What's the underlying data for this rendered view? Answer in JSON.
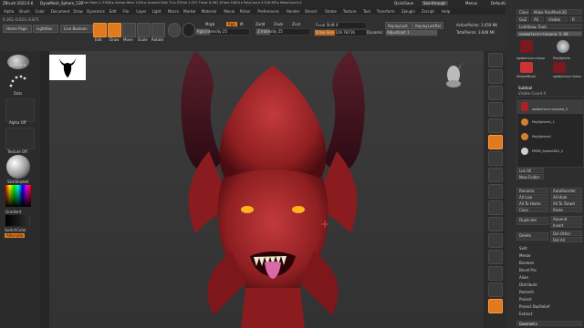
{
  "window": {
    "title": "ZBrush 2022.0.6",
    "doc": "DynaMesh_Sphere_128",
    "stats": "Free Mem 1.79GB ▸ Active Mem 1220 ▸ Scratch Disk 72 ▸ ZTime 1.037 Timer 0.061 ATime 0.604 ▸ PolyCount 4.016 MP ▸ MeshCount 4",
    "quicksave": "QuickSave",
    "seethrough": "See-through",
    "menus_label": "Menus",
    "script": "DefaultZScript",
    "coords": "0.163,-0.623,-0.871"
  },
  "menu": [
    "Alpha",
    "Brush",
    "Color",
    "Document",
    "Draw",
    "Dynamics",
    "Edit",
    "File",
    "Layer",
    "Light",
    "Macro",
    "Marker",
    "Material",
    "Movie",
    "Picker",
    "Preferences",
    "Render",
    "Stencil",
    "Stroke",
    "Texture",
    "Tool",
    "Transform",
    "Zplugin",
    "Zscript",
    "Help"
  ],
  "toolbar": {
    "home_page": "Home Page",
    "lightbox": "LightBox",
    "live_boolean": "Live Boolean",
    "edit": "Edit",
    "draw": "Draw",
    "move": "Move",
    "scale": "Scale",
    "rotate": "Rotate",
    "mrgb": "Mrgb",
    "rgb": "Rgb",
    "m": "M",
    "zadd": "Zadd",
    "zsub": "Zsub",
    "zcut": "Zcut",
    "rgb_intensity": "Rgb Intensity 25",
    "z_intensity": "Z Intensity 25",
    "focal_shift": "Focal Shift 0",
    "draw_size": "Draw Size 119.78716",
    "dynamic": "Dynamic",
    "replaylast": "ReplayLast",
    "replaylastrel": "ReplayLastRel",
    "adjustlast": "AdjustLast 1",
    "active_points": "ActivePoints: 3.059 Mil",
    "total_points": "TotalPoints: 3.848 Mil"
  },
  "left_shelf": {
    "brush": "Standard",
    "stroke": "Dots",
    "alpha": "Alpha Off",
    "texture": "Texture Off",
    "material": "SkinShade4",
    "gradient": "Gradient",
    "switchcolor": "SwitchColor",
    "alternate": "Alternate"
  },
  "right_panel": {
    "clone": "Clone",
    "make_polymesh": "Make PolyMesh3D",
    "goz": "GoZ",
    "all": "All",
    "visible": "Visible",
    "r": "R",
    "lightbox_tools": "Lightbox▸ Tools",
    "tool_name": "кривиться страшна_3. 48",
    "subtool": "Subtool",
    "visible_count": "Visible Count 4",
    "subtools": [
      "кривиться страшна_3",
      "PolySphere1_1",
      "PolySphere1",
      "PM3D_Sphere3D1_2"
    ],
    "list_all": "List All",
    "new_folder": "New Folder",
    "rename": "Rename",
    "autoreorder": "AutoReorder",
    "all_low": "All Low",
    "all_high": "All High",
    "all_to_home": "All To Home",
    "all_to_target": "All To Target",
    "copy": "Copy",
    "paste": "Paste",
    "duplicate": "Duplicate",
    "append": "Append",
    "insert": "Insert",
    "delete": "Delete",
    "del_other": "Del Other",
    "del_all": "Del All",
    "split": "Split",
    "merge": "Merge",
    "boolean": "Boolean",
    "bevel_pro": "Bevel Pro",
    "align": "Align",
    "distribute": "Distribute",
    "remesh": "Remesh",
    "project": "Project",
    "project_bas": "Project BasRelief",
    "extract": "Extract",
    "geometry": "Geometry",
    "tool_thumbs": [
      "кривиться страш",
      "PolySphere",
      "SimpleBrush",
      "кривиться страш"
    ]
  },
  "colors": {
    "accent": "#e07a1f",
    "mesh": "#b52a2a",
    "panel": "#2e2e2e"
  }
}
